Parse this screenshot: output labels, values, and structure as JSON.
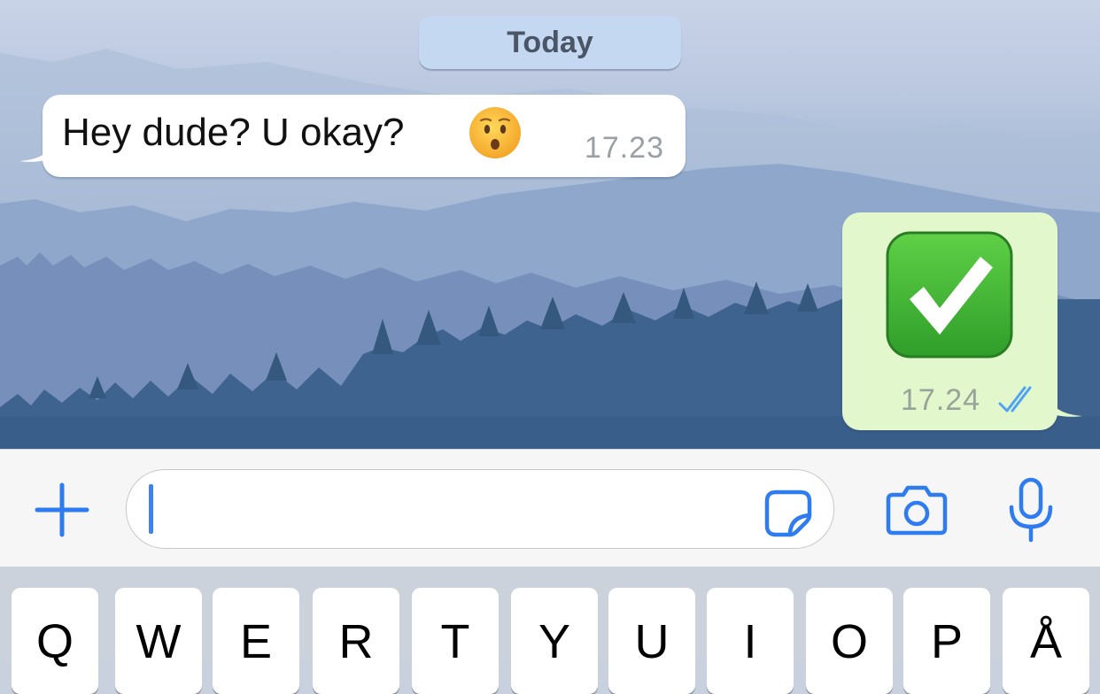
{
  "date_separator": "Today",
  "messages": [
    {
      "direction": "incoming",
      "text": "Hey dude? U okay?",
      "emoji": "hushed-face",
      "time": "17.23"
    },
    {
      "direction": "outgoing",
      "emoji": "white-heavy-check-mark",
      "time": "17.24",
      "status": "read"
    }
  ],
  "input_bar": {
    "plus_icon": "plus-icon",
    "field_value": "",
    "sticker_icon": "sticker-icon",
    "camera_icon": "camera-icon",
    "mic_icon": "microphone-icon"
  },
  "keyboard": {
    "row1": [
      "Q",
      "W",
      "E",
      "R",
      "T",
      "Y",
      "U",
      "I",
      "O",
      "P",
      "Å"
    ]
  },
  "colors": {
    "accent": "#2f7bf0",
    "incoming_bubble": "#ffffff",
    "outgoing_bubble": "#e2f7cb",
    "date_pill": "#c4d8f2",
    "read_ticks": "#4fa3f7"
  }
}
